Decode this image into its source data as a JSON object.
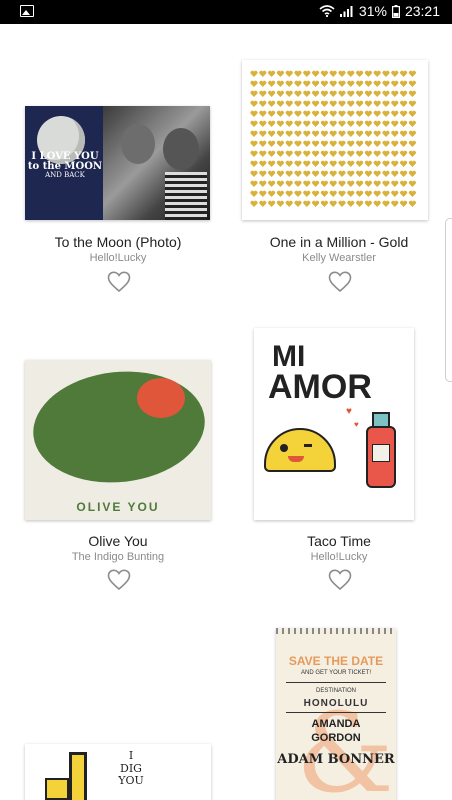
{
  "status_bar": {
    "battery_percent": "31%",
    "time": "23:21"
  },
  "cards": [
    {
      "title": "To the Moon (Photo)",
      "author": "Hello!Lucky",
      "image_text": [
        "I LOVE YOU",
        "to the MOON",
        "AND BACK"
      ]
    },
    {
      "title": "One in a Million - Gold",
      "author": "Kelly Wearstler"
    },
    {
      "title": "Olive You",
      "author": "The Indigo Bunting",
      "image_text": "OLIVE YOU"
    },
    {
      "title": "Taco Time",
      "author": "Hello!Lucky",
      "image_text": [
        "MI",
        "AMOR"
      ]
    },
    {
      "image_text": [
        "I",
        "DIG",
        "YOU"
      ]
    },
    {
      "image_text": [
        "SAVE THE DATE",
        "AND GET YOUR TICKET!",
        "DESTINATION",
        "HONOLULU",
        "AMANDA",
        "GORDON",
        "ADAM BONNER"
      ]
    }
  ],
  "colors": {
    "olive_green": "#4f7a3a",
    "pimento_red": "#e0563a",
    "gold": "#d9b23c",
    "navy": "#1e2750"
  }
}
